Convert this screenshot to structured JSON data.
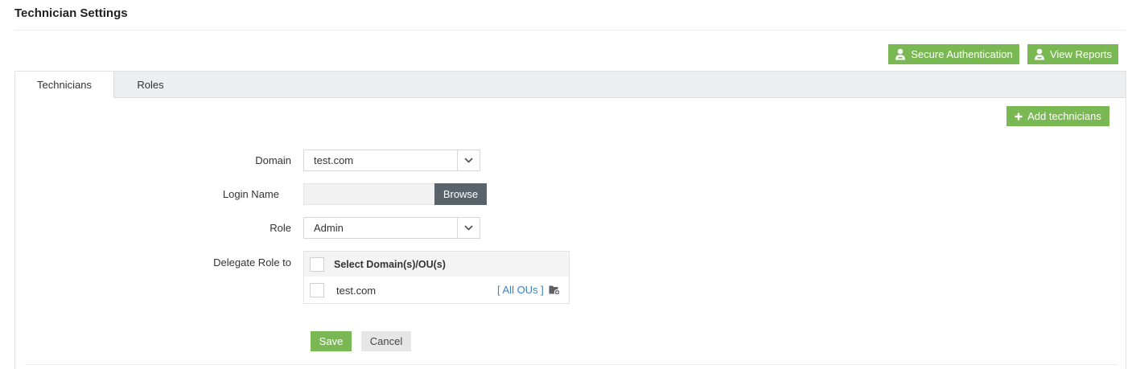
{
  "page": {
    "title": "Technician Settings"
  },
  "header_buttons": {
    "secure_auth_label": "Secure Authentication",
    "view_reports_label": "View Reports",
    "icon": "user-icon"
  },
  "tabs": [
    {
      "label": "Technicians",
      "active": true
    },
    {
      "label": "Roles",
      "active": false
    }
  ],
  "toolbar": {
    "add_technicians_label": "Add technicians",
    "add_icon": "plus-icon"
  },
  "form": {
    "domain_label": "Domain",
    "domain_value": "test.com",
    "login_name_label": "Login Name",
    "login_name_value": "",
    "browse_label": "Browse",
    "role_label": "Role",
    "role_value": "Admin",
    "delegate_label": "Delegate Role to",
    "delegate_header": "Select Domain(s)/OU(s)",
    "delegate_rows": [
      {
        "domain": "test.com",
        "ou_link": "[ All OUs ]",
        "checked": false
      }
    ],
    "save_label": "Save",
    "cancel_label": "Cancel"
  },
  "colors": {
    "accent_green": "#7ab853",
    "browse_dark": "#5a636a",
    "link_blue": "#3a7fc1"
  }
}
